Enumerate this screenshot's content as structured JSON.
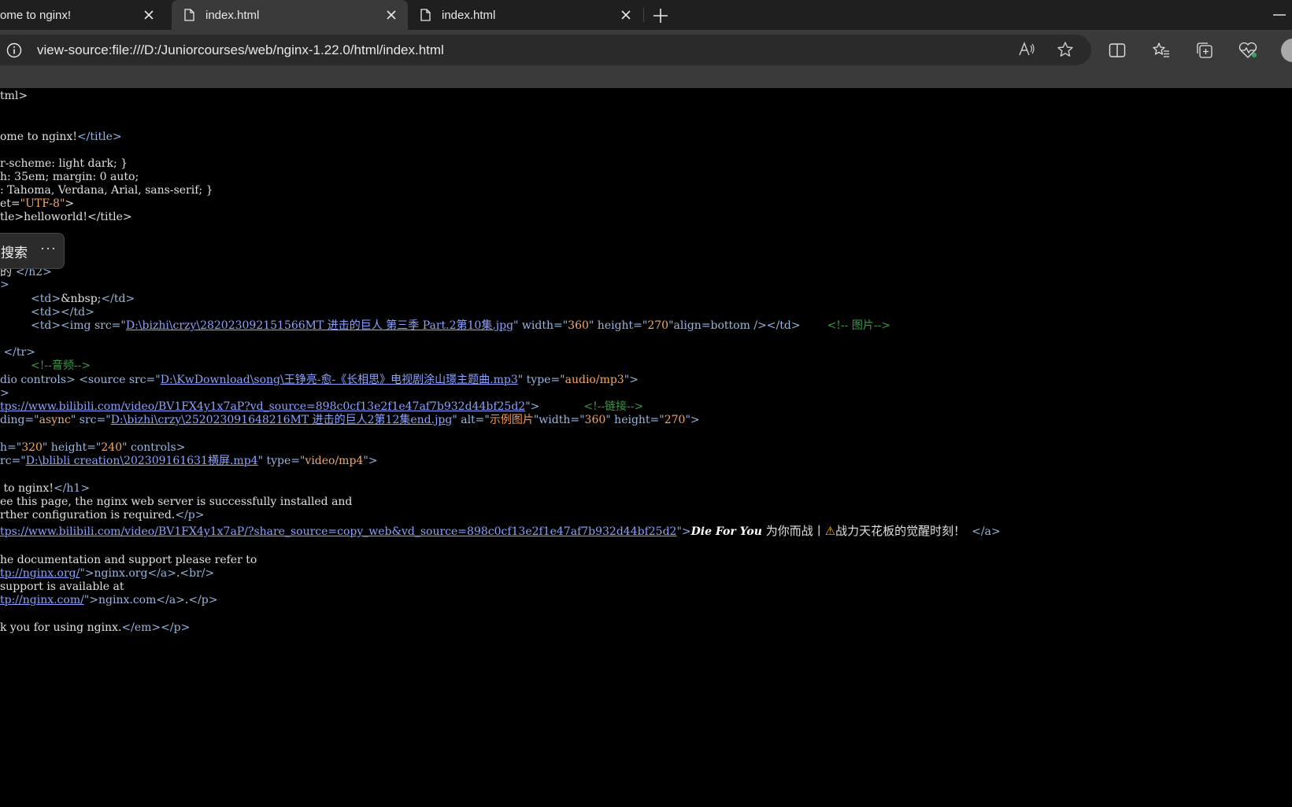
{
  "tabs": [
    {
      "title": "ome to nginx!",
      "active": false
    },
    {
      "title": "index.html",
      "active": true
    },
    {
      "title": "index.html",
      "active": false
    }
  ],
  "address": {
    "url": "view-source:file:///D:/Juniorcourses/web/nginx-1.22.0/html/index.html"
  },
  "popup": {
    "label": "搜索",
    "more": "···"
  },
  "source_lines": [
    [
      "tml>"
    ],
    [
      "ome to nginx!",
      "</title>"
    ],
    [
      "r-scheme: light dark; }"
    ],
    [
      "h: 35em; margin: 0 auto;"
    ],
    [
      ": Tahoma, Verdana, Arial, sans-serif; }"
    ],
    [
      "et=",
      "\"UTF-8\"",
      ">"
    ],
    [
      "tle>helloworld!</title>"
    ],
    [
      "的 ",
      "</h2>"
    ],
    [
      ">"
    ],
    [
      "<td>",
      "&nbsp;",
      "</td>"
    ],
    [
      "<td></td>"
    ],
    [
      "<td><img src=\"",
      "D:\\bizhi\\crzy\\282023092151566MT 进击的巨人 第三季 Part.2第10集.jpg",
      "\" width=\"",
      "360",
      "\" height=\"",
      "270",
      "\"align=bottom />",
      "</td>",
      "<!-- 图片-->"
    ],
    [
      " </tr>"
    ],
    [
      "<!--音频-->"
    ],
    [
      "dio controls> <source src=\"",
      "D:\\KwDownload\\song\\王铮亮-愈-《长相思》电视剧涂山璟主题曲.mp3",
      "\" type=\"",
      "audio/mp3",
      "\">"
    ],
    [
      ">"
    ],
    [
      "tps://www.bilibili.com/video/BV1FX4y1x7aP?vd_source=898c0cf13e2f1e47af7b932d44bf25d2",
      "\">",
      "<!--链接-->"
    ],
    [
      "ding=\"",
      "async",
      "\" src=\"",
      "D:\\bizhi\\crzy\\252023091648216MT 进击的巨人2第12集end.jpg",
      "\" alt=\"",
      "示例图片",
      "\"width=\"",
      "360",
      "\" height=\"",
      "270",
      "\">"
    ],
    [
      "h=\"",
      "320",
      "\" height=\"",
      "240",
      "\" controls>"
    ],
    [
      "rc=\"",
      "D:\\blibli creation\\202309161631横屏.mp4",
      "\" type=\"",
      "video/mp4",
      "\">"
    ],
    [
      " to nginx!",
      "</h1>"
    ],
    [
      "ee this page, the nginx web server is successfully installed and"
    ],
    [
      "rther configuration is required.",
      "</p>"
    ],
    [
      "tps://www.bilibili.com/video/BV1FX4y1x7aP/?share_source=copy_web&vd_source=898c0cf13e2f1e47af7b932d44bf25d2",
      "\">",
      "Die For You",
      " 为你而战丨",
      "⚠",
      "战力天花板的觉醒时刻！",
      "</a>"
    ],
    [
      "he documentation and support please refer to"
    ],
    [
      "tp://nginx.org/",
      "\">nginx.org",
      "</a>",
      ".",
      "<br/>"
    ],
    [
      "support is available at"
    ],
    [
      "tp://nginx.com/",
      "\">nginx.com",
      "</a>",
      ".",
      "</p>"
    ],
    [
      "k you for using nginx.",
      "</em></p>"
    ]
  ]
}
